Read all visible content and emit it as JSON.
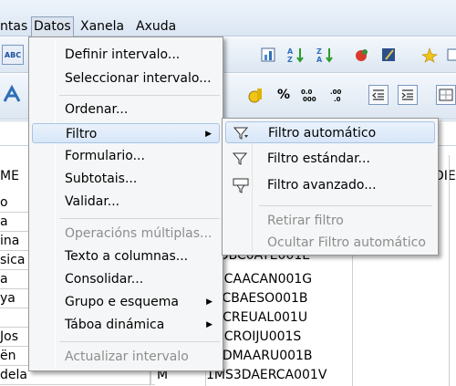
{
  "menubar": {
    "items": [
      {
        "label": "ntas"
      },
      {
        "label": "Datos"
      },
      {
        "label": "Xanela"
      },
      {
        "label": "Axuda"
      }
    ]
  },
  "toolbar": {
    "percent": "%",
    "abc": "ABC"
  },
  "sheet": {
    "header_left": "ME",
    "header_right": "DIE",
    "rows": [
      {
        "name": "o",
        "g": "",
        "code": ""
      },
      {
        "name": "a",
        "g": "",
        "code": ""
      },
      {
        "name": "ina",
        "g": "",
        "code": ""
      },
      {
        "name": "sica",
        "g": "",
        "code": ""
      },
      {
        "name": "a",
        "g": "",
        "code": "DSCAACAN001G"
      },
      {
        "name": "ya",
        "g": "",
        "code": "0XCBAESO001B"
      },
      {
        "name": "",
        "g": "",
        "code": "AXCREUAL001U"
      },
      {
        "name": "Jos",
        "g": "",
        "code": "2DCROIJU001S"
      },
      {
        "name": "ën",
        "g": "",
        "code": "58DMAARU001B"
      },
      {
        "name": "dela",
        "g": "M",
        "code": "1MS3DAERCA001V"
      }
    ],
    "partial_code": "WDBC0ATE001E"
  },
  "menu": {
    "items": [
      {
        "label": "Definir intervalo...",
        "disabled": false
      },
      {
        "label": "Seleccionar intervalo...",
        "disabled": false
      },
      {
        "label": "Ordenar...",
        "disabled": false
      },
      {
        "label": "Filtro",
        "disabled": false,
        "submenu": true
      },
      {
        "label": "Formulario...",
        "disabled": false
      },
      {
        "label": "Subtotais...",
        "disabled": false
      },
      {
        "label": "Validar...",
        "disabled": false
      },
      {
        "label": "Operacións múltiplas...",
        "disabled": true
      },
      {
        "label": "Texto a columnas...",
        "disabled": false
      },
      {
        "label": "Consolidar...",
        "disabled": false
      },
      {
        "label": "Grupo e esquema",
        "disabled": false,
        "submenu": true
      },
      {
        "label": "Táboa dinámica",
        "disabled": false,
        "submenu": true
      },
      {
        "label": "Actualizar intervalo",
        "disabled": true
      }
    ]
  },
  "submenu": {
    "items": [
      {
        "label": "Filtro automático",
        "icon": "autofilter-icon"
      },
      {
        "label": "Filtro estándar...",
        "icon": "standard-filter-icon"
      },
      {
        "label": "Filtro avanzado...",
        "icon": "advanced-filter-icon"
      },
      {
        "label": "Retirar filtro",
        "disabled": true
      },
      {
        "label": "Ocultar Filtro automático",
        "disabled": true
      }
    ]
  }
}
